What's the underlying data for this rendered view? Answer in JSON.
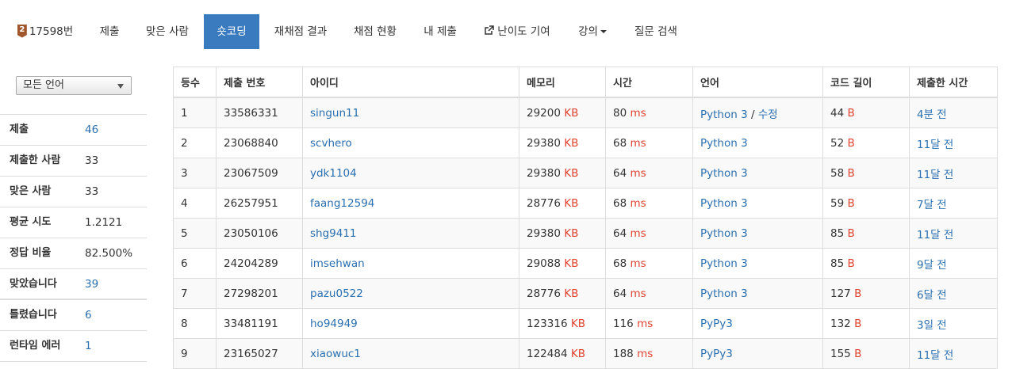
{
  "nav": {
    "problem_number": "17598번",
    "medal_text": "2",
    "tabs": [
      {
        "label": "제출"
      },
      {
        "label": "맞은 사람"
      },
      {
        "label": "숏코딩"
      },
      {
        "label": "재채점 결과"
      },
      {
        "label": "채점 현황"
      },
      {
        "label": "내 제출"
      },
      {
        "label": "난이도 기여"
      },
      {
        "label": "강의"
      },
      {
        "label": "질문 검색"
      }
    ],
    "active_tab": "숏코딩",
    "active_color": "#3a7bbf"
  },
  "sidebar": {
    "language_select": "모든 언어",
    "stats": [
      {
        "label": "제출",
        "value": "46",
        "is_link": true
      },
      {
        "label": "제출한 사람",
        "value": "33",
        "is_link": false
      },
      {
        "label": "맞은 사람",
        "value": "33",
        "is_link": false
      },
      {
        "label": "평균 시도",
        "value": "1.2121",
        "is_link": false
      },
      {
        "label": "정답 비율",
        "value": "82.500%",
        "is_link": false
      },
      {
        "label": "맞았습니다",
        "value": "39",
        "is_link": true
      },
      {
        "label": "틀렸습니다",
        "value": "6",
        "is_link": true
      },
      {
        "label": "런타임 에러",
        "value": "1",
        "is_link": true
      }
    ]
  },
  "table": {
    "headers": [
      "등수",
      "제출 번호",
      "아이디",
      "메모리",
      "시간",
      "언어",
      "코드 길이",
      "제출한 시간"
    ],
    "units": {
      "memory": "KB",
      "time": "ms",
      "code": "B"
    },
    "edit_label": "수정",
    "rows": [
      {
        "rank": "1",
        "submit_id": "33586331",
        "user": "singun11",
        "memory": "29200",
        "time": "80",
        "lang": "Python 3",
        "edit": true,
        "code": "44",
        "when": "4분 전"
      },
      {
        "rank": "2",
        "submit_id": "23068840",
        "user": "scvhero",
        "memory": "29380",
        "time": "68",
        "lang": "Python 3",
        "edit": false,
        "code": "52",
        "when": "11달 전"
      },
      {
        "rank": "3",
        "submit_id": "23067509",
        "user": "ydk1104",
        "memory": "29380",
        "time": "64",
        "lang": "Python 3",
        "edit": false,
        "code": "58",
        "when": "11달 전"
      },
      {
        "rank": "4",
        "submit_id": "26257951",
        "user": "faang12594",
        "memory": "28776",
        "time": "68",
        "lang": "Python 3",
        "edit": false,
        "code": "59",
        "when": "7달 전"
      },
      {
        "rank": "5",
        "submit_id": "23050106",
        "user": "shg9411",
        "memory": "29380",
        "time": "64",
        "lang": "Python 3",
        "edit": false,
        "code": "85",
        "when": "11달 전"
      },
      {
        "rank": "6",
        "submit_id": "24204289",
        "user": "imsehwan",
        "memory": "29088",
        "time": "68",
        "lang": "Python 3",
        "edit": false,
        "code": "85",
        "when": "9달 전"
      },
      {
        "rank": "7",
        "submit_id": "27298201",
        "user": "pazu0522",
        "memory": "28776",
        "time": "64",
        "lang": "Python 3",
        "edit": false,
        "code": "127",
        "when": "6달 전"
      },
      {
        "rank": "8",
        "submit_id": "33481191",
        "user": "ho94949",
        "memory": "123316",
        "time": "116",
        "lang": "PyPy3",
        "edit": false,
        "code": "132",
        "when": "3일 전"
      },
      {
        "rank": "9",
        "submit_id": "23165027",
        "user": "xiaowuc1",
        "memory": "122484",
        "time": "188",
        "lang": "PyPy3",
        "edit": false,
        "code": "155",
        "when": "11달 전"
      }
    ]
  }
}
